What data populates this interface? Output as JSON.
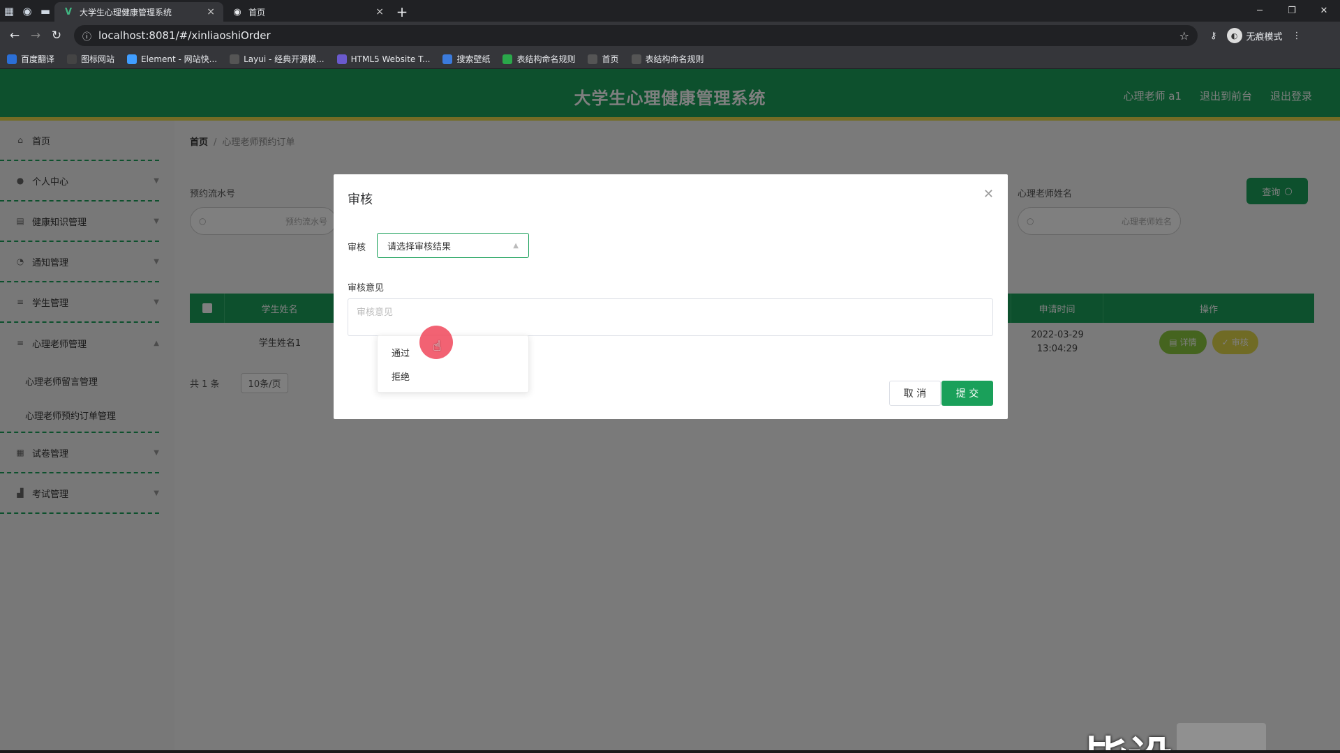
{
  "browser": {
    "tabs": [
      {
        "title": "大学生心理健康管理系统",
        "active": true
      },
      {
        "title": "首页",
        "active": false
      }
    ],
    "url": "localhost:8081/#/xinliaoshiOrder",
    "profile_label": "无痕模式",
    "bookmarks": [
      {
        "label": "百度翻译",
        "color": "#2b6fd6"
      },
      {
        "label": "图标网站",
        "color": "#444444"
      },
      {
        "label": "Element - 网站快...",
        "color": "#409eff"
      },
      {
        "label": "Layui - 经典开源模...",
        "color": "#555555"
      },
      {
        "label": "HTML5 Website T...",
        "color": "#6a5acd"
      },
      {
        "label": "搜索壁纸",
        "color": "#3b7bdc"
      },
      {
        "label": "表结构命名规则",
        "color": "#2aa84a"
      },
      {
        "label": "首页",
        "color": "#555555"
      },
      {
        "label": "表结构命名规则",
        "color": "#555555"
      }
    ]
  },
  "header": {
    "title": "大学生心理健康管理系统",
    "user": "心理老师 a1",
    "back_front": "退出到前台",
    "logout": "退出登录"
  },
  "sidebar": {
    "items": [
      {
        "label": "首页",
        "icon": "home-icon"
      },
      {
        "label": "个人中心",
        "icon": "user-icon"
      },
      {
        "label": "健康知识管理",
        "icon": "doc-icon"
      },
      {
        "label": "通知管理",
        "icon": "bell-icon"
      },
      {
        "label": "学生管理",
        "icon": "list-icon"
      },
      {
        "label": "心理老师管理",
        "icon": "list-icon"
      }
    ],
    "subitems": [
      "心理老师留言管理",
      "心理老师预约订单管理"
    ],
    "items_after": [
      {
        "label": "试卷管理",
        "icon": "grid-icon"
      },
      {
        "label": "考试管理",
        "icon": "chart-icon"
      }
    ]
  },
  "main": {
    "breadcrumb": {
      "home": "首页",
      "current": "心理老师预约订单"
    },
    "filters": {
      "order_no_label": "预约流水号",
      "order_no_placeholder": "预约流水号",
      "teacher_label": "心理老师姓名",
      "teacher_placeholder": "心理老师姓名",
      "query": "查询"
    },
    "table": {
      "headers": [
        "学生姓名",
        "申请时间",
        "操作"
      ],
      "row": {
        "student": "学生姓名1",
        "time": "2022-03-29 13:04:29"
      },
      "detail_btn": "详情",
      "audit_btn": "审核"
    },
    "pager": {
      "total": "共 1 条",
      "size": "10条/页"
    }
  },
  "dialog": {
    "title": "审核",
    "audit_label": "审核",
    "select_placeholder": "请选择审核结果",
    "opinion_label": "审核意见",
    "opinion_placeholder": "审核意见",
    "options": [
      "通过",
      "拒绝"
    ],
    "cancel": "取 消",
    "submit": "提 交"
  },
  "watermark": "毕设"
}
